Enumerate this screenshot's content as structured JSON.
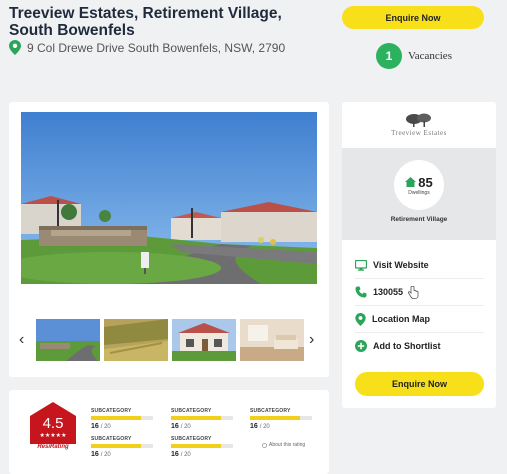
{
  "listing": {
    "title": "Treeview Estates, Retirement Village, South Bowenfels",
    "address": "9 Col Drewe Drive South Bowenfels, NSW, 2790"
  },
  "enquire_label": "Enquire Now",
  "vacancies": {
    "count": "1",
    "label": "Vacancies"
  },
  "gallery": {
    "main_photo": "village-entrance-photo",
    "thumbnails": [
      "village-entrance",
      "grass-field",
      "villa-exterior",
      "interior-room"
    ]
  },
  "sidebar": {
    "logo_text": "Treeview Estates",
    "dwellings_count": "85",
    "dwellings_label": "Dwellings",
    "village_type": "Retirement Village",
    "links": [
      {
        "label": "Visit Website",
        "icon": "monitor-icon"
      },
      {
        "label": "130055",
        "icon": "phone-icon"
      },
      {
        "label": "Location Map",
        "icon": "map-pin-icon"
      },
      {
        "label": "Add to Shortlist",
        "icon": "plus-circle-icon"
      }
    ],
    "enquire_label": "Enquire Now"
  },
  "rating": {
    "value": "4.5",
    "stars": "★★★★★",
    "badge_label": "ResiRating",
    "subcategories": [
      {
        "label": "SUBCATEGORY",
        "score": "16",
        "out_of": "/ 20",
        "fraction": 0.8
      },
      {
        "label": "SUBCATEGORY",
        "score": "16",
        "out_of": "/ 20",
        "fraction": 0.8
      },
      {
        "label": "SUBCATEGORY",
        "score": "16",
        "out_of": "/ 20",
        "fraction": 0.8
      },
      {
        "label": "SUBCATEGORY",
        "score": "16",
        "out_of": "/ 20",
        "fraction": 0.8
      },
      {
        "label": "SUBCATEGORY",
        "score": "16",
        "out_of": "/ 20",
        "fraction": 0.8
      }
    ],
    "about_label": "About this rating"
  },
  "colors": {
    "accent_yellow": "#f7e01a",
    "vacancy_green": "#2cb25e",
    "icon_green": "#2aa55a",
    "rating_red": "#c7151d"
  }
}
